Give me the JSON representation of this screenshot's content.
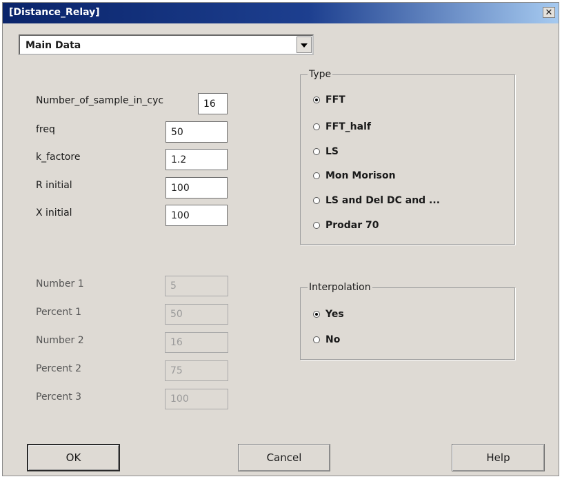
{
  "window": {
    "title": "[Distance_Relay]",
    "close_glyph": "✕"
  },
  "combo": {
    "selected": "Main Data"
  },
  "params": [
    {
      "label": "Number_of_sample_in_cyc",
      "value": "16"
    },
    {
      "label": "freq",
      "value": "50"
    },
    {
      "label": "k_factore",
      "value": "1.2"
    },
    {
      "label": "R initial",
      "value": "100"
    },
    {
      "label": "X initial",
      "value": "100"
    }
  ],
  "disabled_params": [
    {
      "label": "Number 1",
      "value": "5"
    },
    {
      "label": "Percent 1",
      "value": "50"
    },
    {
      "label": "Number 2",
      "value": "16"
    },
    {
      "label": "Percent 2",
      "value": "75"
    },
    {
      "label": "Percent 3",
      "value": "100"
    }
  ],
  "type_group": {
    "title": "Type",
    "selected": "FFT",
    "options": [
      "FFT",
      "FFT_half",
      "LS",
      "Mon Morison",
      "LS and Del DC and ...",
      "Prodar 70"
    ]
  },
  "interp_group": {
    "title": "Interpolation",
    "selected": "Yes",
    "options": [
      "Yes",
      "No"
    ]
  },
  "buttons": {
    "ok": "OK",
    "cancel": "Cancel",
    "help": "Help"
  }
}
